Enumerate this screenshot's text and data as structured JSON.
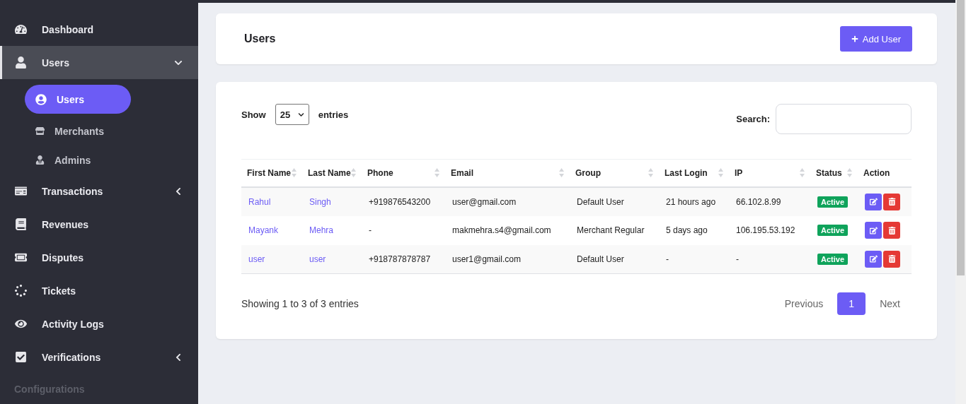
{
  "sidebar": {
    "items": [
      {
        "label": "Dashboard",
        "selected": false
      },
      {
        "label": "Users",
        "selected": true,
        "expanded": true,
        "children": [
          {
            "label": "Users",
            "selected": true
          },
          {
            "label": "Merchants",
            "selected": false
          },
          {
            "label": "Admins",
            "selected": false
          }
        ]
      },
      {
        "label": "Transactions",
        "selected": false,
        "expanded": false
      },
      {
        "label": "Revenues",
        "selected": false
      },
      {
        "label": "Disputes",
        "selected": false
      },
      {
        "label": "Tickets",
        "selected": false
      },
      {
        "label": "Activity Logs",
        "selected": false
      },
      {
        "label": "Verifications",
        "selected": false,
        "expanded": false
      }
    ],
    "section_label": "Configurations"
  },
  "header": {
    "title": "Users",
    "add_button": "Add User"
  },
  "table_controls": {
    "show_label": "Show",
    "page_size": "25",
    "entries_label": "entries",
    "search_label": "Search:"
  },
  "table": {
    "columns": [
      {
        "label": "First Name",
        "sortable": true
      },
      {
        "label": "Last Name",
        "sortable": true
      },
      {
        "label": "Phone",
        "sortable": true
      },
      {
        "label": "Email",
        "sortable": true
      },
      {
        "label": "Group",
        "sortable": true
      },
      {
        "label": "Last Login",
        "sortable": true
      },
      {
        "label": "IP",
        "sortable": true
      },
      {
        "label": "Status",
        "sortable": true
      },
      {
        "label": "Action",
        "sortable": false
      }
    ],
    "rows": [
      {
        "first_name": "Rahul",
        "last_name": "Singh",
        "phone": "+919876543200",
        "email": "user@gmail.com",
        "group": "Default User",
        "last_login": "21 hours ago",
        "ip": "66.102.8.99",
        "status": "Active"
      },
      {
        "first_name": "Mayank",
        "last_name": "Mehra",
        "phone": "-",
        "email": "makmehra.s4@gmail.com",
        "group": "Merchant Regular",
        "last_login": "5 days ago",
        "ip": "106.195.53.192",
        "status": "Active"
      },
      {
        "first_name": "user",
        "last_name": "user",
        "phone": "+918787878787",
        "email": "user1@gmail.com",
        "group": "Default User",
        "last_login": "-",
        "ip": "-",
        "status": "Active"
      }
    ]
  },
  "footer": {
    "info": "Showing 1 to 3 of 3 entries",
    "previous": "Previous",
    "pages": [
      {
        "label": "1",
        "selected": true
      }
    ],
    "next": "Next"
  }
}
